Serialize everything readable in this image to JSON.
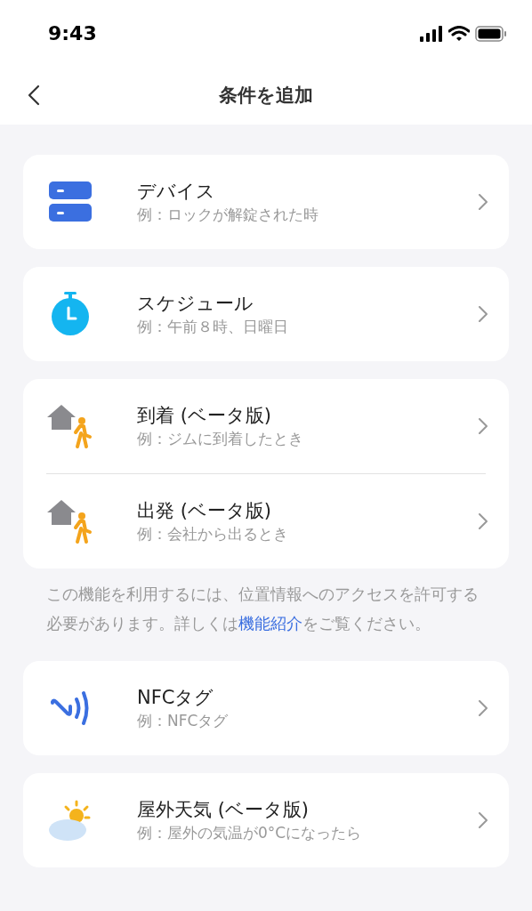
{
  "status_bar": {
    "time": "9:43"
  },
  "header": {
    "title": "条件を追加"
  },
  "groups": [
    {
      "items": [
        {
          "kind": "device",
          "title": "デバイス",
          "subtitle": "例：ロックが解錠された時"
        }
      ]
    },
    {
      "items": [
        {
          "kind": "schedule",
          "title": "スケジュール",
          "subtitle": "例：午前８時、日曜日"
        }
      ]
    },
    {
      "items": [
        {
          "kind": "arrive",
          "title": "到着 (ベータ版)",
          "subtitle": "例：ジムに到着したとき"
        },
        {
          "kind": "leave",
          "title": "出発 (ベータ版)",
          "subtitle": "例：会社から出るとき"
        }
      ],
      "note": {
        "before": "この機能を利用するには、位置情報へのアクセスを許可する必要があります。詳しくは",
        "link": "機能紹介",
        "after": "をご覧ください。"
      }
    },
    {
      "items": [
        {
          "kind": "nfc",
          "title": "NFCタグ",
          "subtitle": "例：NFCタグ"
        }
      ]
    },
    {
      "items": [
        {
          "kind": "weather",
          "title": "屋外天気 (ベータ版)",
          "subtitle": "例：屋外の気温が0°Cになったら"
        }
      ]
    }
  ]
}
